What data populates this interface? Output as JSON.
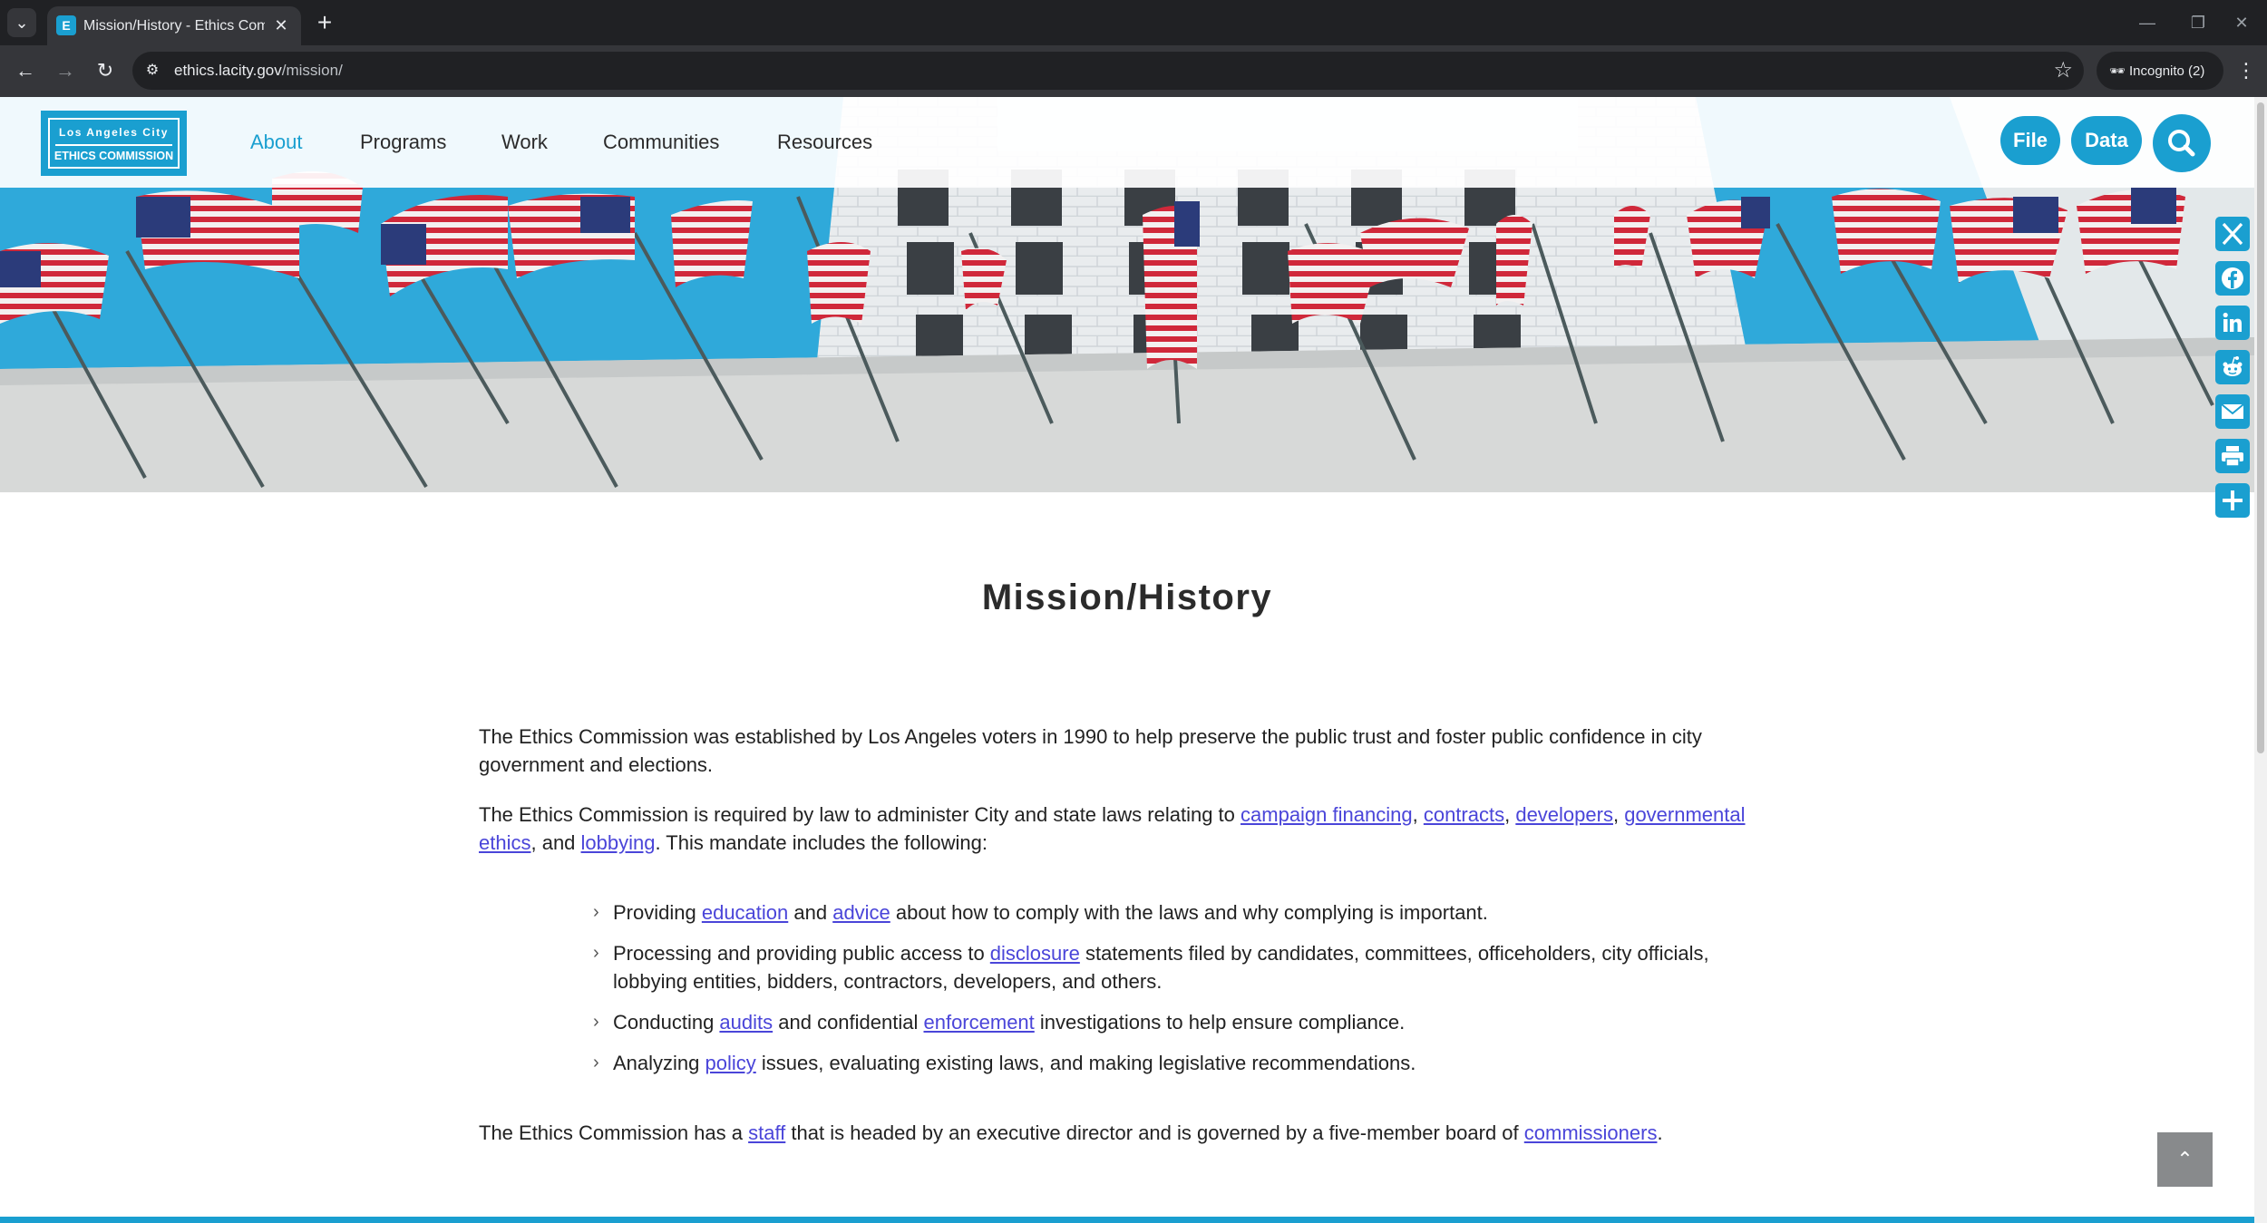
{
  "browser": {
    "tab_title": "Mission/History - Ethics Commission",
    "favicon_letter": "E",
    "url_host": "ethics.lacity.gov",
    "url_path": "/mission/",
    "incognito_label": "Incognito (2)"
  },
  "site": {
    "logo_top": "Los Angeles City",
    "logo_bottom": "ETHICS COMMISSION",
    "nav": [
      "About",
      "Programs",
      "Work",
      "Communities",
      "Resources"
    ],
    "active_nav": "About",
    "file_button": "File",
    "data_button": "Data",
    "accent_color": "#1a9fd0",
    "link_color": "#4a45d9"
  },
  "share": [
    "x-icon",
    "facebook-icon",
    "linkedin-icon",
    "reddit-icon",
    "email-icon",
    "print-icon",
    "share-plus-icon"
  ],
  "page": {
    "title": "Mission/History",
    "p1": "The Ethics Commission was established by Los Angeles voters in 1990 to help preserve the public trust and foster public confidence in city government and elections.",
    "p2": {
      "t1": "The Ethics Commission is required by law to administer City and state laws relating to ",
      "l1": "campaign financing",
      "t2": ", ",
      "l2": "contracts",
      "t3": ", ",
      "l3": "developers",
      "t4": ", ",
      "l4": "governmental ethics",
      "t5": ", and ",
      "l5": "lobbying",
      "t6": ". This mandate includes the following:"
    },
    "bullets": [
      {
        "t1": "Providing ",
        "l1": "education",
        "t2": " and ",
        "l2": "advice",
        "t3": " about how to comply with the laws and why complying is important."
      },
      {
        "t1": "Processing and providing public access to ",
        "l1": "disclosure",
        "t2": " statements filed by candidates, committees, officeholders, city officials, lobbying entities, bidders, contractors, developers, and others."
      },
      {
        "t1": "Conducting ",
        "l1": "audits",
        "t2": " and confidential ",
        "l2": "enforcement",
        "t3": " investigations to help ensure compliance."
      },
      {
        "t1": "Analyzing ",
        "l1": "policy",
        "t2": " issues, evaluating existing laws, and making legislative recommendations."
      }
    ],
    "p3": {
      "t1": "The Ethics Commission has a ",
      "l1": "staff",
      "t2": " that is headed by an executive director and is governed by a five-member board of ",
      "l2": "commissioners",
      "t3": "."
    }
  }
}
